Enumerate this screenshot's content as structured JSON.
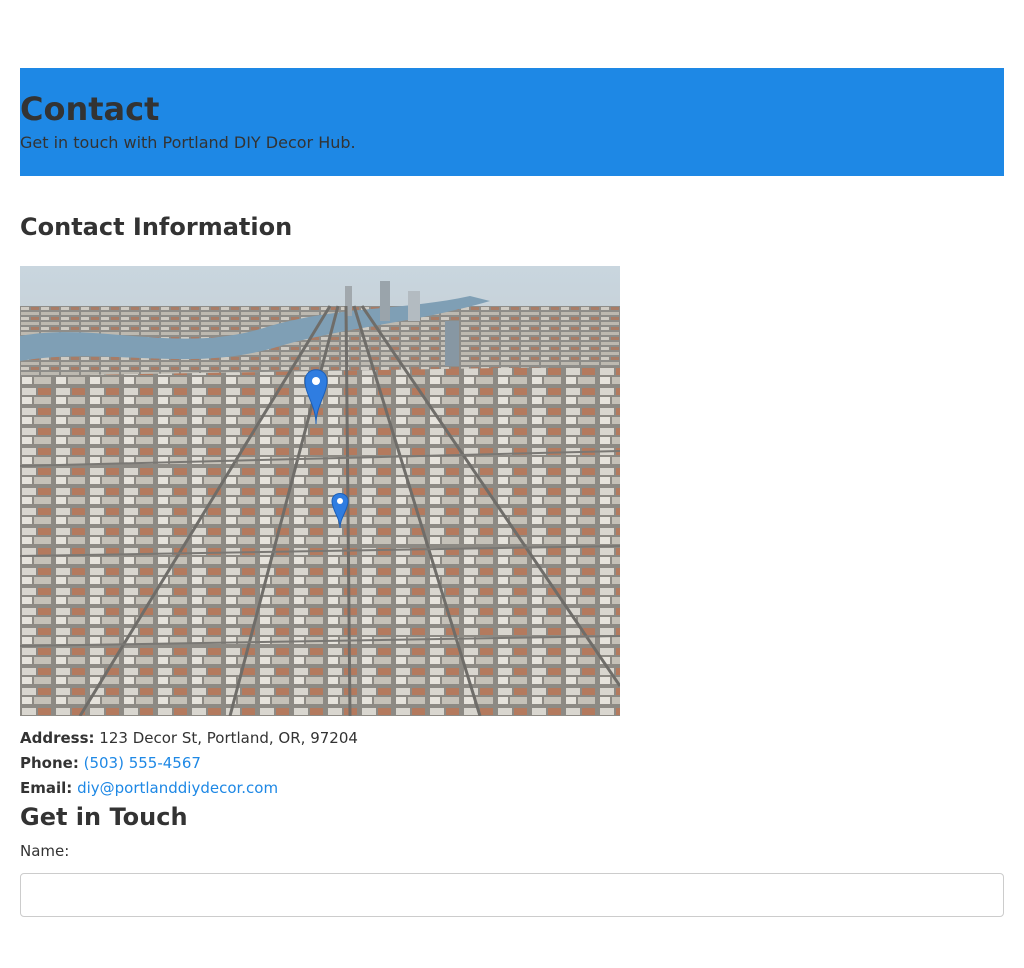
{
  "hero": {
    "title": "Contact",
    "subtitle": "Get in touch with Portland DIY Decor Hub."
  },
  "contact_info": {
    "heading": "Contact Information",
    "address_label": "Address:",
    "address_value": "123 Decor St, Portland, OR, 97204",
    "phone_label": "Phone:",
    "phone_value": "(503) 555-4567",
    "email_label": "Email:",
    "email_value": "diy@portlanddiydecor.com"
  },
  "form": {
    "heading": "Get in Touch",
    "name_label": "Name:",
    "name_value": ""
  },
  "colors": {
    "hero_bg": "#1e88e5",
    "link": "#1e88e5",
    "text": "#333333"
  },
  "icons": {
    "map_marker": "map-marker-icon"
  }
}
